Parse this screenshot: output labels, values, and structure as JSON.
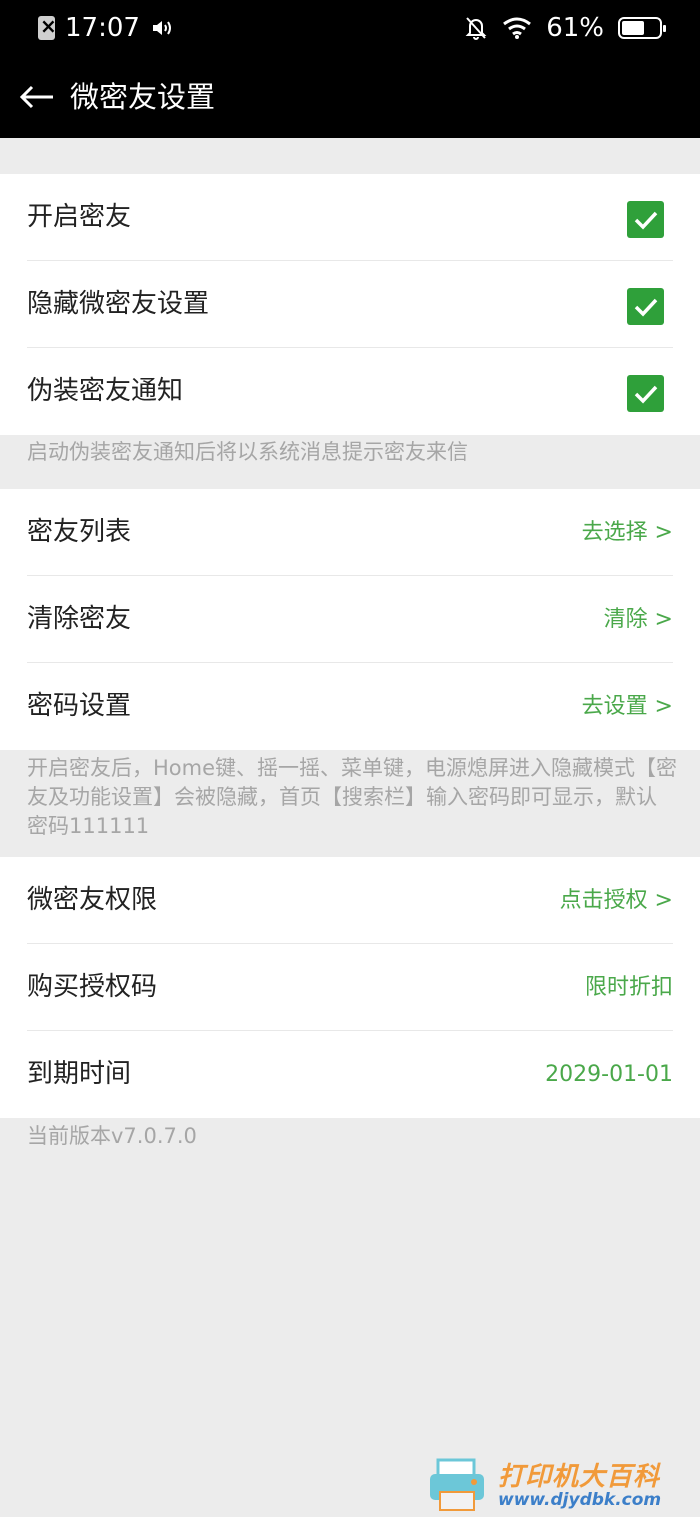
{
  "status_bar": {
    "time": "17:07",
    "battery_percent": "61%",
    "battery_level": 0.61,
    "icons": [
      "sim-error-icon",
      "speaker-icon",
      "bell-off-icon",
      "wifi-icon",
      "battery-icon"
    ]
  },
  "toolbar": {
    "title": "微密友设置",
    "back_icon": "arrow-left-icon"
  },
  "section1": {
    "items": [
      {
        "label": "开启密友",
        "checked": true
      },
      {
        "label": "隐藏微密友设置",
        "checked": true
      },
      {
        "label": "伪装密友通知",
        "checked": true
      }
    ],
    "note": "启动伪装密友通知后将以系统消息提示密友来信"
  },
  "section2": {
    "items": [
      {
        "label": "密友列表",
        "value": "去选择 >"
      },
      {
        "label": "清除密友",
        "value": "清除 >"
      },
      {
        "label": "密码设置",
        "value": "去设置 >"
      }
    ],
    "note": "开启密友后，Home键、摇一摇、菜单键，电源熄屏进入隐藏模式【密友及功能设置】会被隐藏，首页【搜索栏】输入密码即可显示，默认密码111111"
  },
  "section3": {
    "items": [
      {
        "label": "微密友权限",
        "value": "点击授权 >"
      },
      {
        "label": "购买授权码",
        "value": "限时折扣"
      },
      {
        "label": "到期时间",
        "value": "2029-01-01"
      }
    ],
    "note": "当前版本v7.0.7.0"
  },
  "watermark": {
    "text": "打印机大百科",
    "url": "www.djydbk.com"
  },
  "colors": {
    "accent_green": "#4aa84a",
    "checkbox_green": "#2fa03a",
    "toolbar_bg": "#000000",
    "page_bg": "#ececec"
  }
}
